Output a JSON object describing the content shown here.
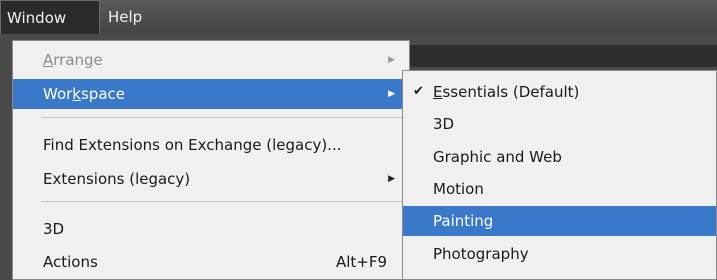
{
  "menubar": {
    "window_label": "Window",
    "help_label": "Help"
  },
  "window_menu": {
    "items": [
      {
        "label_pre": "",
        "label_ul": "A",
        "label_post": "rrange",
        "disabled": true,
        "submenu": true
      },
      {
        "label_pre": "Wor",
        "label_ul": "k",
        "label_post": "space",
        "highlighted": true,
        "submenu": true
      },
      {
        "label": "Find Extensions on Exchange (legacy)..."
      },
      {
        "label": "Extensions (legacy)",
        "submenu": true
      },
      {
        "label": "3D"
      },
      {
        "label": "Actions",
        "shortcut": "Alt+F9"
      }
    ]
  },
  "workspace_menu": {
    "items": [
      {
        "label_ul": "E",
        "label_post": "ssentials (Default)",
        "checked": true,
        "check_glyph": "✔"
      },
      {
        "label": "3D"
      },
      {
        "label": "Graphic and Web"
      },
      {
        "label": "Motion"
      },
      {
        "label": "Painting",
        "highlighted": true
      },
      {
        "label": "Photography"
      }
    ]
  },
  "icons": {
    "submenu_arrow": "▶",
    "checkmark": "✔"
  },
  "colors": {
    "highlight": "#3a78c9",
    "menu_bg": "#f0f0f0",
    "menubar_bg": "#4a4a4a"
  }
}
